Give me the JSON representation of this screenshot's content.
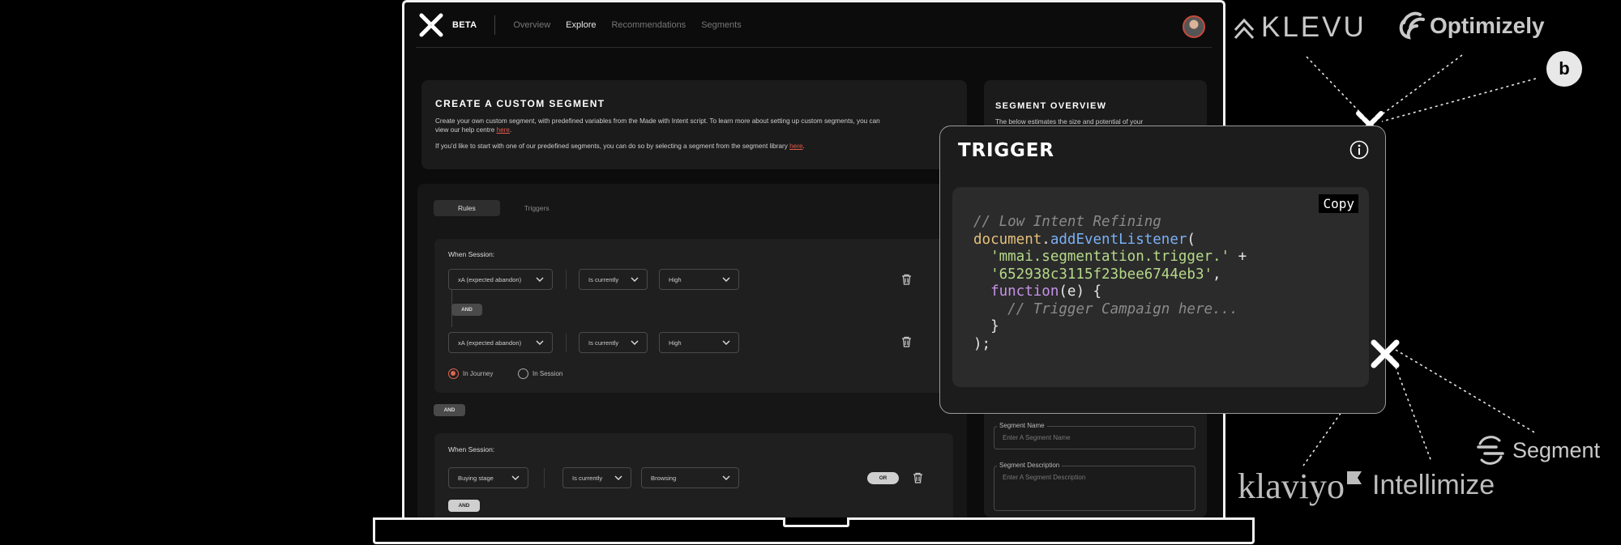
{
  "nav": {
    "beta": "BETA",
    "links": [
      "Overview",
      "Explore",
      "Recommendations",
      "Segments"
    ]
  },
  "intro": {
    "title": "Create a custom segment",
    "p1_text": "Create your own custom segment, with predefined variables from the Made with Intent script. To learn more about setting up custom segments, you can view our help centre ",
    "p1_link": "here",
    "p1_end": ".",
    "p2_text": "If you'd like to start with one of our predefined segments, you can do so by selecting a segment from the segment library ",
    "p2_link": "here",
    "p2_end": "."
  },
  "rules": {
    "tabs": [
      "Rules",
      "Triggers"
    ],
    "group1": {
      "heading": "When Session:",
      "row1": [
        "xA (expected abandon)",
        "Is currently",
        "High"
      ],
      "and_pill": "AND",
      "row2": [
        "xA (expected abandon)",
        "Is currently",
        "High"
      ],
      "radio_journey": "In Journey",
      "radio_session": "In Session"
    },
    "between_and": "AND",
    "group2": {
      "heading": "When Session:",
      "row1": [
        "Buying stage",
        "Is currently",
        "Browsing"
      ],
      "or_pill": "OR",
      "and_pill": "AND"
    }
  },
  "overview": {
    "title": "Segment overview",
    "subtitle": "The below estimates the size and potential of your",
    "name_label": "Segment Name",
    "name_placeholder": "Enter A Segment Name",
    "desc_label": "Segment Description",
    "desc_placeholder": "Enter A Segment Description"
  },
  "trigger": {
    "title": "TRIGGER",
    "copy_label": "Copy",
    "code": {
      "comment1": "// Low Intent Refining",
      "obj": "document",
      "method": "addEventListener",
      "str1": "'mmai.segmentation.trigger.'",
      "str2": "'652938c3115f23bee6744eb3'",
      "kw": "function",
      "param": "(e) {",
      "comment2": "// Trigger Campaign here..."
    }
  },
  "brands": {
    "klevu": "KLEVU",
    "optimizely": "Optimizely",
    "segment": "Segment",
    "klaviyo": "klaviyo",
    "intellimize": "Intellimize",
    "b_icon": "b"
  },
  "colors": {
    "accent": "#e55a4a",
    "code_string": "#b6d98a",
    "code_function": "#7ab0f5",
    "code_keyword": "#c792ea",
    "code_object": "#e5c07b"
  }
}
